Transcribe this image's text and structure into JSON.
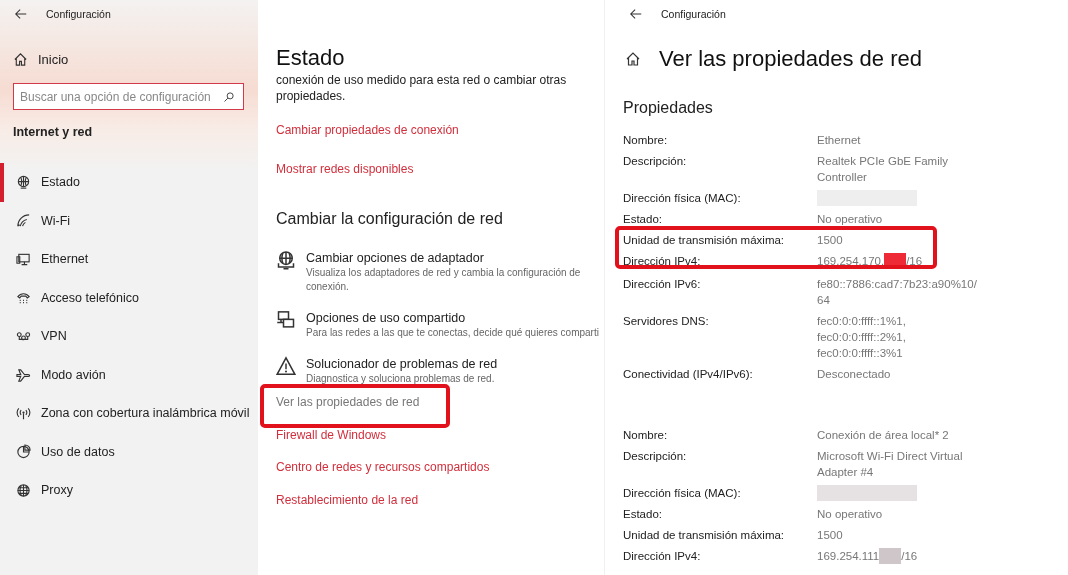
{
  "sidebar": {
    "title": "Configuración",
    "home": "Inicio",
    "search": {
      "placeholder": "Buscar una opción de configuración"
    },
    "section": "Internet y red",
    "items": [
      {
        "label": "Estado",
        "kind": "status",
        "selected": true
      },
      {
        "label": "Wi-Fi",
        "kind": "wifi",
        "selected": false
      },
      {
        "label": "Ethernet",
        "kind": "ethernet",
        "selected": false
      },
      {
        "label": "Acceso telefónico",
        "kind": "dialup",
        "selected": false
      },
      {
        "label": "VPN",
        "kind": "vpn",
        "selected": false
      },
      {
        "label": "Modo avión",
        "kind": "airplane",
        "selected": false
      },
      {
        "label": "Zona con cobertura inalámbrica móvil",
        "kind": "hotspot",
        "selected": false
      },
      {
        "label": "Uso de datos",
        "kind": "data",
        "selected": false
      },
      {
        "label": "Proxy",
        "kind": "proxy",
        "selected": false
      }
    ]
  },
  "status_page": {
    "title": "Estado",
    "intro": [
      "conexión de uso medido para esta red o cambiar otras",
      "propiedades."
    ],
    "top_links": [
      "Cambiar propiedades de conexión",
      "Mostrar redes disponibles"
    ],
    "section": "Cambiar la configuración de red",
    "options": [
      {
        "kind": "adapter",
        "title": "Cambiar opciones de adaptador",
        "description": "Visualiza los adaptadores de red y cambia la configuración de conexión."
      },
      {
        "kind": "sharing",
        "title": "Opciones de uso compartido",
        "description": "Para las redes a las que te conectas, decide qué quieres comparti"
      },
      {
        "kind": "troubleshoot",
        "title": "Solucionador de problemas de red",
        "description": "Diagnostica y soluciona problemas de red."
      }
    ],
    "links": [
      {
        "label": "Ver las propiedades de red",
        "visited": true,
        "highlighted": true
      },
      {
        "label": "Firewall de Windows",
        "visited": false,
        "highlighted": false
      },
      {
        "label": "Centro de redes y recursos compartidos",
        "visited": false,
        "highlighted": false
      },
      {
        "label": "Restablecimiento de la red",
        "visited": false,
        "highlighted": false
      }
    ]
  },
  "properties_page": {
    "window_title": "Configuración",
    "title": "Ver las propiedades de red",
    "section": "Propiedades",
    "adapters": [
      {
        "rows": [
          {
            "label": "Nombre:",
            "lines": [
              "Ethernet"
            ]
          },
          {
            "label": "Descripción:",
            "lines": [
              "Realtek PCIe GbE Family",
              "Controller"
            ]
          },
          {
            "label": "Dirección física (MAC):",
            "redaction": {
              "color": "#eeeeee"
            }
          },
          {
            "label": "Estado:",
            "lines": [
              "No operativo"
            ]
          },
          {
            "label": "Unidad de transmisión máxima:",
            "lines": [
              "1500"
            ],
            "highlighted": true
          },
          {
            "label": "Dirección IPv4:",
            "lines": [
              "169.254.170."
            ],
            "redaction": {
              "color": "#ee2a36"
            },
            "suffix": "/16",
            "highlighted": true
          },
          {
            "label": "Dirección IPv6:",
            "lines": [
              "fe80::7886:cad7:7b23:a90%10/",
              "64"
            ]
          },
          {
            "label": "Servidores DNS:",
            "lines": [
              "fec0:0:0:ffff::1%1,",
              "fec0:0:0:ffff::2%1,",
              "fec0:0:0:ffff::3%1"
            ]
          },
          {
            "label": "Conectividad (IPv4/IPv6):",
            "lines": [
              "Desconectado"
            ]
          }
        ]
      },
      {
        "rows": [
          {
            "label": "Nombre:",
            "lines": [
              "Conexión de área local* 2"
            ]
          },
          {
            "label": "Descripción:",
            "lines": [
              "Microsoft Wi-Fi Direct Virtual",
              "Adapter #4"
            ]
          },
          {
            "label": "Dirección física (MAC):",
            "redaction": {
              "color": "#e6e2e4"
            }
          },
          {
            "label": "Estado:",
            "lines": [
              "No operativo"
            ]
          },
          {
            "label": "Unidad de transmisión máxima:",
            "lines": [
              "1500"
            ]
          },
          {
            "label": "Dirección IPv4:",
            "lines": [
              "169.254.111"
            ],
            "redaction": {
              "color": "#cfc6ca"
            },
            "suffix": "/16"
          }
        ]
      }
    ]
  }
}
